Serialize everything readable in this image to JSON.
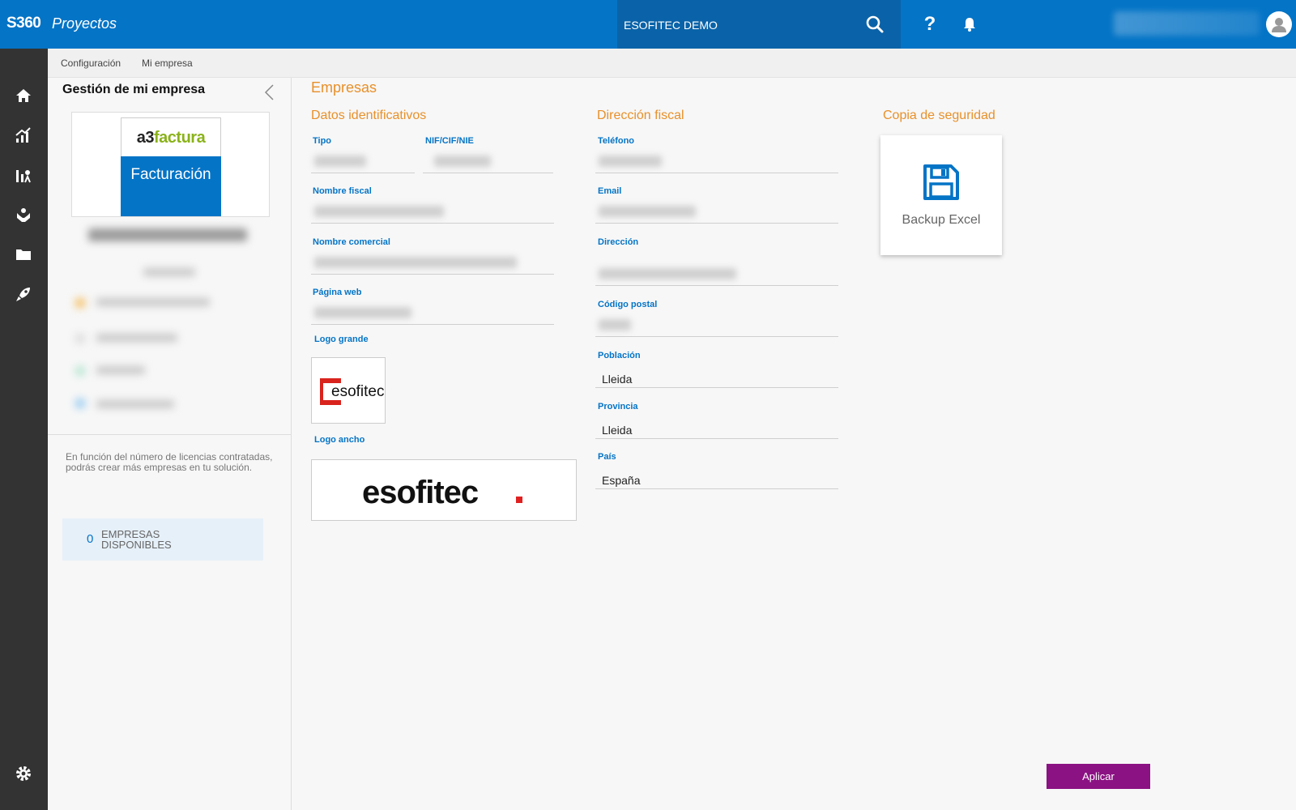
{
  "header": {
    "brand": "S360",
    "module": "Proyectos",
    "company_value": "ESOFITEC DEMO",
    "help_label": "?"
  },
  "breadcrumb": [
    "Configuración",
    "Mi empresa"
  ],
  "left_panel": {
    "title": "Gestión de mi empresa",
    "product_logo_top_a": "a3",
    "product_logo_top_b": "factura",
    "product_logo_bottom": "Facturación",
    "license_note": "En función del número de licencias contratadas, podrás crear más empresas en tu solución.",
    "available_count": "0",
    "available_label": "EMPRESAS DISPONIBLES"
  },
  "main": {
    "title": "Empresas",
    "sections": {
      "identificativos": "Datos identificativos",
      "fiscal": "Dirección fiscal",
      "backup": "Copia de seguridad"
    },
    "labels": {
      "tipo": "Tipo",
      "nif": "NIF/CIF/NIE",
      "nombre_fiscal": "Nombre fiscal",
      "nombre_comercial": "Nombre comercial",
      "pagina_web": "Página web",
      "logo_grande": "Logo grande",
      "logo_ancho": "Logo ancho",
      "telefono": "Teléfono",
      "email": "Email",
      "direccion": "Dirección",
      "codigo_postal": "Código postal",
      "poblacion": "Población",
      "provincia": "Provincia",
      "pais": "País"
    },
    "values": {
      "poblacion": "Lleida",
      "provincia": "Lleida",
      "pais": "España"
    },
    "logo_small_text": "esofitec",
    "logo_wide_text": "esofitec",
    "backup_label": "Backup Excel",
    "apply_label": "Aplicar"
  },
  "colors": {
    "primary": "#0474c6",
    "accent_orange": "#e8902a",
    "apply": "#8b1283",
    "nav_bg": "#333333",
    "logo_red": "#e02020"
  }
}
